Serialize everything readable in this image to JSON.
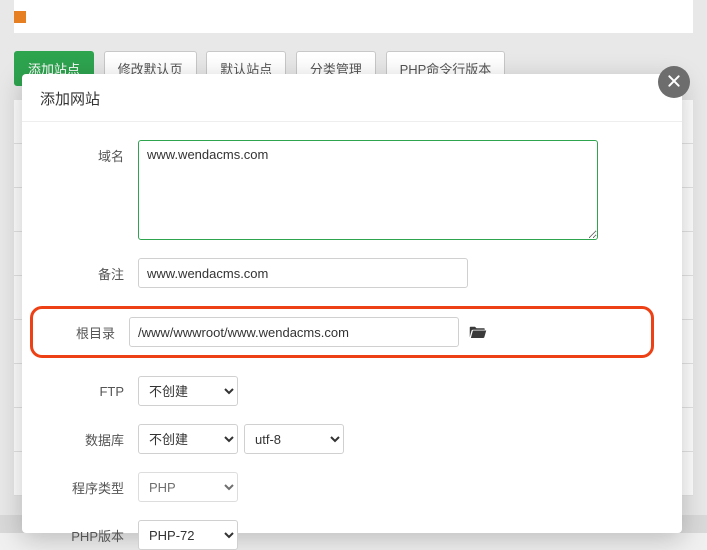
{
  "toolbar": {
    "add_site": "添加站点",
    "modify_default": "修改默认页",
    "default_site": "默认站点",
    "category_mgmt": "分类管理",
    "php_cli_ver": "PHP命令行版本"
  },
  "modal": {
    "title": "添加网站"
  },
  "form": {
    "domain_label": "域名",
    "domain_value": "www.wendacms.com",
    "remark_label": "备注",
    "remark_value": "www.wendacms.com",
    "root_label": "根目录",
    "root_value": "/www/wwwroot/www.wendacms.com",
    "ftp_label": "FTP",
    "ftp_value": "不创建",
    "db_label": "数据库",
    "db_value": "不创建",
    "charset_value": "utf-8",
    "program_label": "程序类型",
    "program_value": "PHP",
    "phpver_label": "PHP版本",
    "phpver_value": "PHP-72"
  }
}
